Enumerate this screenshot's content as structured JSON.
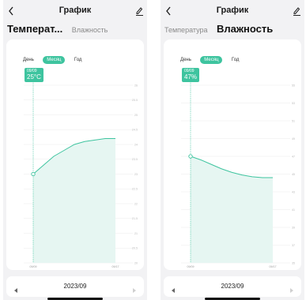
{
  "screens": [
    {
      "title": "График",
      "tabs": [
        {
          "label": "Температ...",
          "active": true
        },
        {
          "label": "Влажность",
          "active": false
        }
      ],
      "periods": [
        {
          "label": "День",
          "selected": false
        },
        {
          "label": "Месяц",
          "selected": true
        },
        {
          "label": "Год",
          "selected": false
        }
      ],
      "tooltip": {
        "date": "09/09",
        "value": "25°C"
      },
      "month": "2023/09",
      "icons": {
        "back": "chevron-left-icon",
        "edit": "edit-pencil-icon",
        "prev": "triangle-left-icon",
        "next": "triangle-right-icon"
      },
      "chart_data": {
        "type": "area",
        "x_labels": [
          "09/09",
          "09/17"
        ],
        "y_ticks": [
          26,
          25.5,
          25,
          24.5,
          24,
          23.5,
          23,
          22.5,
          22,
          21.5,
          21,
          20.5,
          20
        ],
        "ylim": [
          20,
          26
        ],
        "series": [
          {
            "x": [
              "09/09",
              "09/10",
              "09/11",
              "09/12",
              "09/13",
              "09/14",
              "09/15",
              "09/16",
              "09/17"
            ],
            "values": [
              23.0,
              23.3,
              23.6,
              23.8,
              24.0,
              24.1,
              24.15,
              24.2,
              24.2
            ]
          }
        ],
        "highlight_index": 0,
        "color": "#3ec49f"
      }
    },
    {
      "title": "График",
      "tabs": [
        {
          "label": "Температура",
          "active": false
        },
        {
          "label": "Влажность",
          "active": true
        }
      ],
      "periods": [
        {
          "label": "День",
          "selected": false
        },
        {
          "label": "Месяц",
          "selected": true
        },
        {
          "label": "Год",
          "selected": false
        }
      ],
      "tooltip": {
        "date": "09/09",
        "value": "47%"
      },
      "month": "2023/09",
      "icons": {
        "back": "chevron-left-icon",
        "edit": "edit-pencil-icon",
        "prev": "triangle-left-icon",
        "next": "triangle-right-icon"
      },
      "chart_data": {
        "type": "area",
        "x_labels": [
          "09/09",
          "09/17"
        ],
        "y_ticks": [
          55,
          53,
          51,
          49,
          47,
          45,
          43,
          41,
          39,
          37,
          35
        ],
        "ylim": [
          35,
          55
        ],
        "series": [
          {
            "x": [
              "09/09",
              "09/10",
              "09/11",
              "09/12",
              "09/13",
              "09/14",
              "09/15",
              "09/16",
              "09/17"
            ],
            "values": [
              47.0,
              46.6,
              46.1,
              45.6,
              45.2,
              44.9,
              44.7,
              44.6,
              44.6
            ]
          }
        ],
        "highlight_index": 0,
        "color": "#3ec49f"
      }
    }
  ]
}
